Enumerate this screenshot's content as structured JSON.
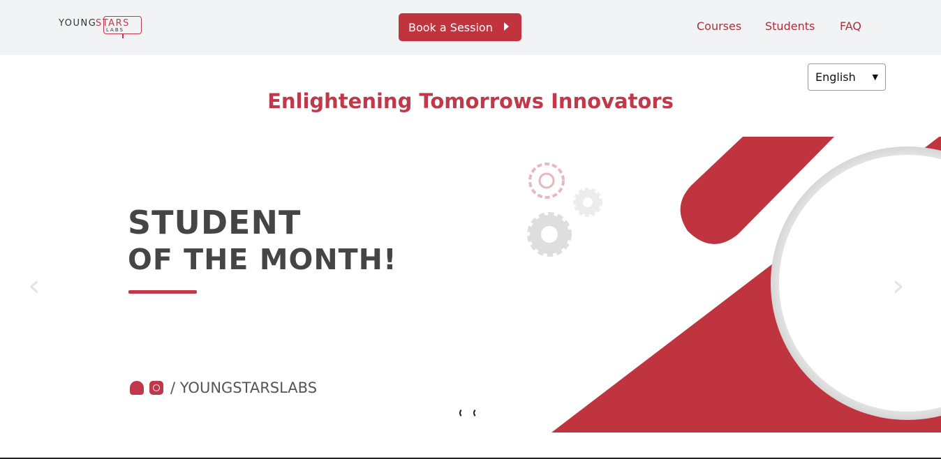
{
  "header": {
    "logo": {
      "word1": "YOUNG",
      "word2": "STARS",
      "word3": "LABS"
    },
    "book_button": "Book a Session",
    "nav": [
      "Courses",
      "Students",
      "FAQ"
    ]
  },
  "language_select": {
    "selected": "English"
  },
  "hero": {
    "headline": "Enlightening Tomorrows Innovators"
  },
  "carousel": {
    "slide_title_line1": "STUDENT",
    "slide_title_line2": "OF THE MONTH!",
    "social_handle": "/ YOUNGSTARSLABS",
    "prev_arrow": "‹",
    "next_arrow": "›",
    "total_slides": 2
  },
  "colors": {
    "brand": "#c0394a",
    "button": "#c0343f",
    "nav_text": "#a8313b",
    "topbar_bg": "#f2f3f5"
  }
}
